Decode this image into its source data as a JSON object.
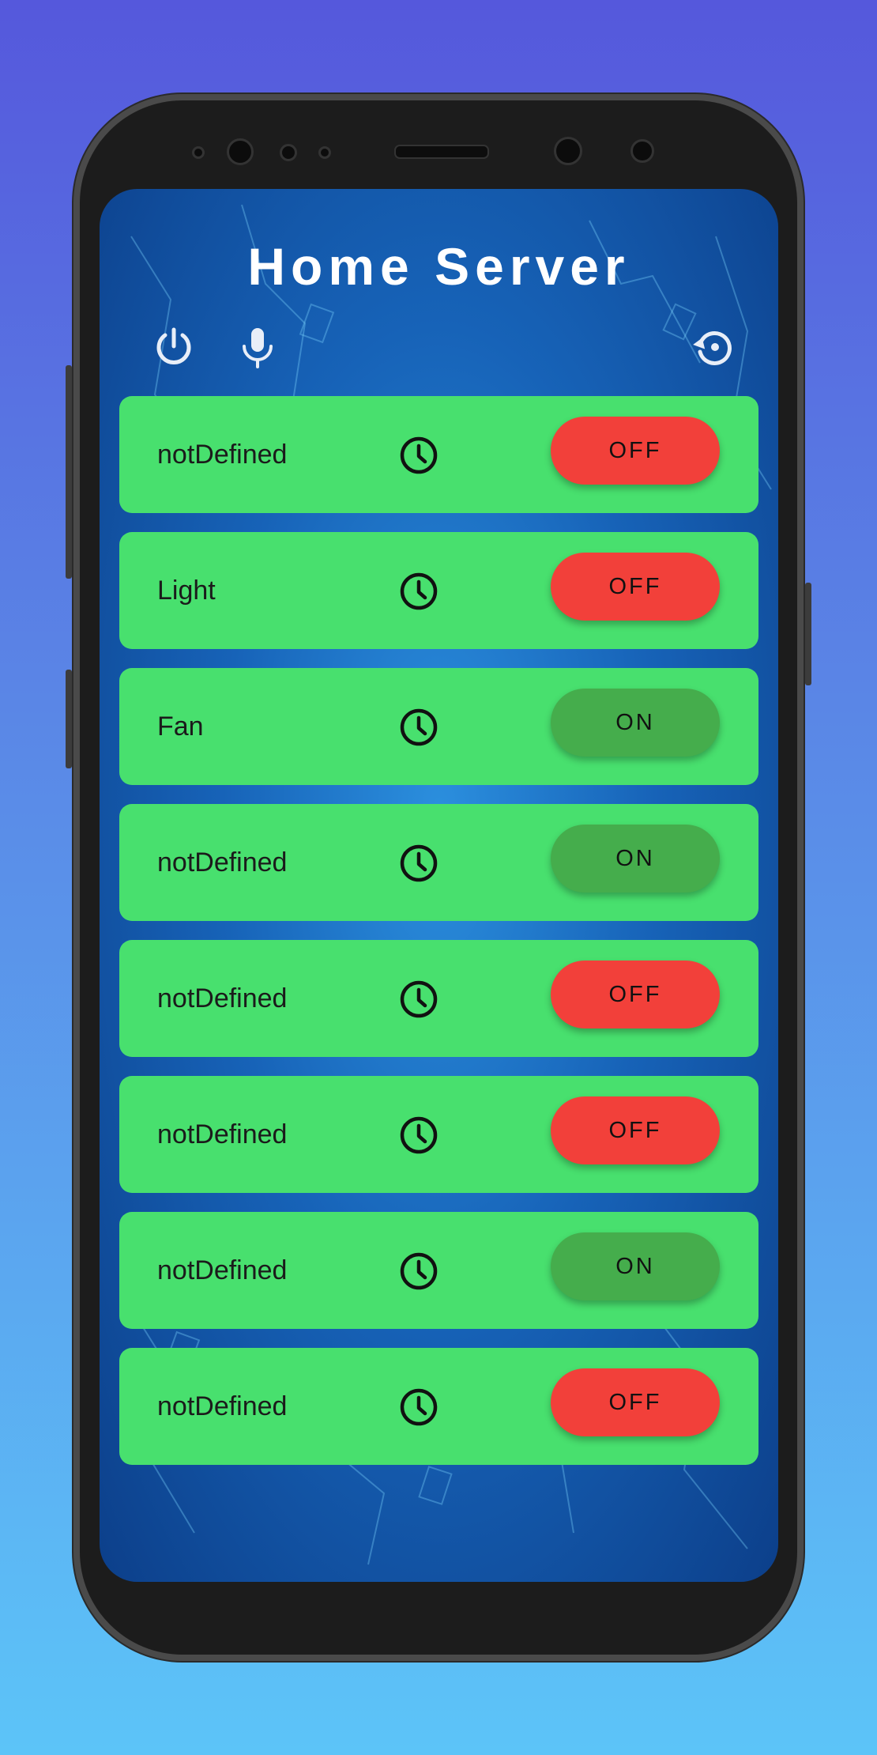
{
  "app": {
    "title": "Home Server"
  },
  "toolbar": {
    "power_icon": "power-icon",
    "mic_icon": "microphone-icon",
    "restore_icon": "restore-icon"
  },
  "devices": [
    {
      "name": "notDefined",
      "state": "OFF"
    },
    {
      "name": "Light",
      "state": "OFF"
    },
    {
      "name": "Fan",
      "state": "ON"
    },
    {
      "name": "notDefined",
      "state": "ON"
    },
    {
      "name": "notDefined",
      "state": "OFF"
    },
    {
      "name": "notDefined",
      "state": "OFF"
    },
    {
      "name": "notDefined",
      "state": "ON"
    },
    {
      "name": "notDefined",
      "state": "OFF"
    }
  ],
  "colors": {
    "row_bg": "#48e06e",
    "off_button": "#f2403a",
    "on_button": "#45ad4c",
    "title": "#ffffff",
    "screen_bg": "#1763b8"
  }
}
